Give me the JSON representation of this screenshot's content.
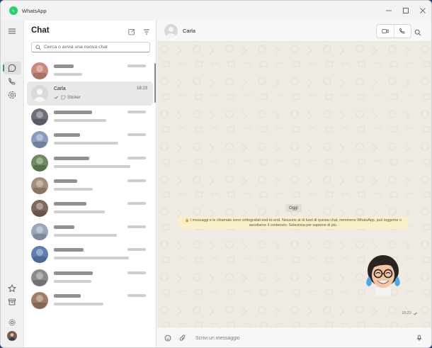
{
  "app": {
    "title": "WhatsApp",
    "brand_color": "#25d366",
    "accent": "#1fa855"
  },
  "window_controls": [
    "minimize-icon",
    "maximize-icon",
    "close-icon"
  ],
  "nav": {
    "top": [
      "menu-icon",
      "chat-icon",
      "phone-icon",
      "status-icon"
    ],
    "bottom": [
      "star-icon",
      "archive-icon",
      "settings-icon",
      "profile-avatar"
    ]
  },
  "sidebar": {
    "title": "Chat",
    "search_placeholder": "Cerca o avvia una nuova chat",
    "chats": [
      {
        "name": "",
        "time": "",
        "preview": "",
        "avatar": "#c98a7c",
        "selected": false
      },
      {
        "name": "Carla",
        "time": "18:23",
        "preview": "Sticker",
        "avatar": "#d9d9d9",
        "selected": true
      },
      {
        "name": "",
        "time": "",
        "preview": "",
        "avatar": "#6d6f7a",
        "selected": false
      },
      {
        "name": "",
        "time": "",
        "preview": "",
        "avatar": "#8a9bbf",
        "selected": false
      },
      {
        "name": "",
        "time": "",
        "preview": "",
        "avatar": "#6e8a5f",
        "selected": false
      },
      {
        "name": "",
        "time": "",
        "preview": "",
        "avatar": "#a58e7a",
        "selected": false
      },
      {
        "name": "",
        "time": "",
        "preview": "",
        "avatar": "#7e6a5d",
        "selected": false
      },
      {
        "name": "",
        "time": "",
        "preview": "",
        "avatar": "#9aa6b8",
        "selected": false
      },
      {
        "name": "",
        "time": "",
        "preview": "",
        "avatar": "#5f7fb2",
        "selected": false
      },
      {
        "name": "",
        "time": "",
        "preview": "",
        "avatar": "#8c8c8c",
        "selected": false
      },
      {
        "name": "",
        "time": "",
        "preview": "",
        "avatar": "#a07b68",
        "selected": false
      }
    ]
  },
  "conversation": {
    "contact_name": "Carla",
    "date_label": "Oggi",
    "encryption_notice_line1": "I messaggi e le chiamate sono crittografati end-to-end. Nessuno al di fuori di questa chat, nemmeno WhatsApp, può leggerne o",
    "encryption_notice_line2": "ascoltarne il contenuto. Seleziona per saperne di più.",
    "sticker_time": "18:23",
    "composer_placeholder": "Scrivi un messaggio"
  }
}
